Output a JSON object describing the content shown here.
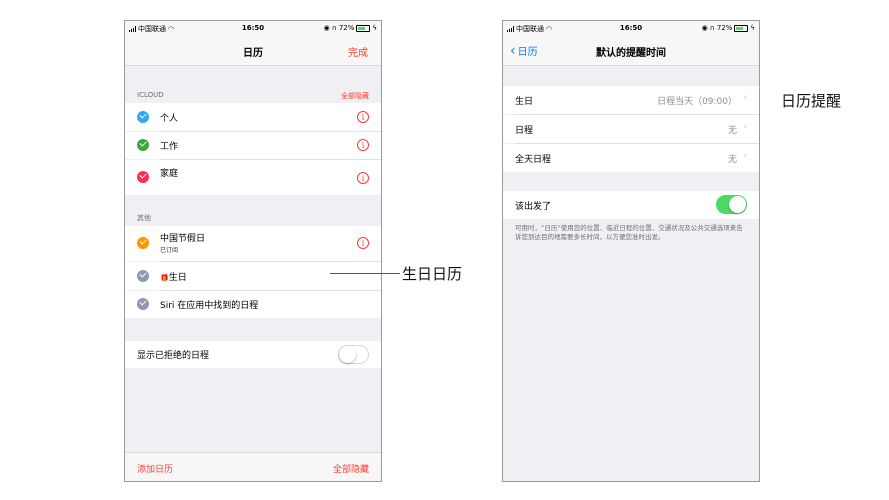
{
  "left_phone": {
    "status": {
      "carrier": "中国联通",
      "time": "16:50",
      "battery": "72%"
    },
    "nav": {
      "title": "日历",
      "done": "完成"
    },
    "icloud": {
      "header": "ICLOUD",
      "hide_all": "全部隐藏",
      "items": [
        {
          "label": "个人",
          "color": "#2fa9ee"
        },
        {
          "label": "工作",
          "color": "#3aa83a"
        },
        {
          "label": "家庭",
          "color": "#ff2d55"
        }
      ]
    },
    "other": {
      "header": "其他",
      "items": [
        {
          "label": "中国节假日",
          "sub": "已订阅",
          "color": "#ff9500"
        },
        {
          "label": "生日",
          "prefix": "🎁",
          "color": "#8e9aaf"
        },
        {
          "label": "Siri 在应用中找到的日程",
          "color": "#8e9aaf"
        }
      ]
    },
    "declined": {
      "label": "显示已拒绝的日程"
    },
    "bottom": {
      "add": "添加日历",
      "hide_all": "全部隐藏"
    }
  },
  "right_phone": {
    "status": {
      "carrier": "中国联通",
      "time": "16:50",
      "battery": "72%"
    },
    "nav": {
      "back": "日历",
      "title": "默认的提醒时间"
    },
    "rows": [
      {
        "label": "生日",
        "value": "日程当天（09:00）"
      },
      {
        "label": "日程",
        "value": "无"
      },
      {
        "label": "全天日程",
        "value": "无"
      }
    ],
    "leave": {
      "label": "该出发了"
    },
    "note": "可用时，“日历”使用您的位置、临近日程的位置、交通状况及公共交通选项来告诉您到达目的地需要多长时间，以方便您准时出发。"
  },
  "annotations": {
    "birthday_calendar": "生日日历",
    "calendar_alerts": "日历提醒"
  },
  "icons": {
    "chevron": "›",
    "info": "i",
    "back": "‹"
  }
}
